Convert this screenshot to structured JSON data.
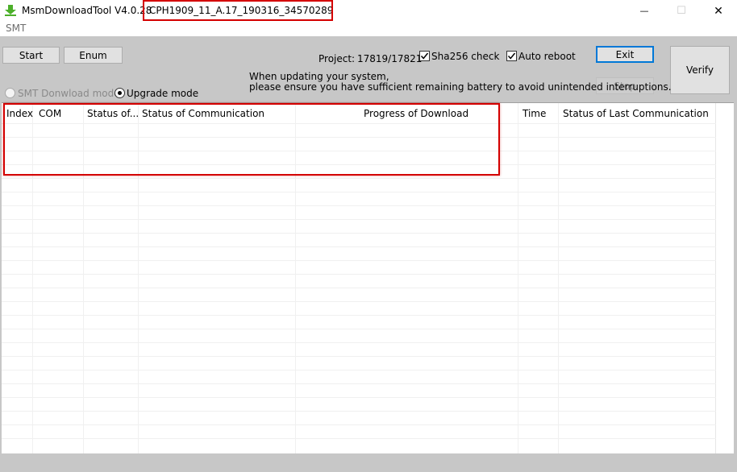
{
  "window": {
    "app_title": "MsmDownloadTool V4.0.28",
    "title_separator": "-",
    "project_name": "CPH1909_11_A.17_190316_34570289",
    "minimize_glyph": "—",
    "maximize_glyph": "☐",
    "close_glyph": "✕"
  },
  "menu": {
    "items": [
      "SMT"
    ]
  },
  "toolbar": {
    "start_label": "Start",
    "enum_label": "Enum",
    "project_label": "Project:",
    "project_value": "17819/17821",
    "sha256_label": "Sha256 check",
    "sha256_checked": true,
    "auto_reboot_label": "Auto reboot",
    "auto_reboot_checked": true,
    "exit_label": "Exit",
    "stop_label": "Stop",
    "verify_label": "Verify",
    "notice_line1": "When updating your system,",
    "notice_line2": "please ensure you have sufficient remaining battery to avoid unintended interruptions.",
    "smt_mode_label": "SMT Donwload mode",
    "upgrade_mode_label": "Upgrade mode",
    "selected_mode": "upgrade"
  },
  "grid": {
    "columns": [
      "Index",
      "COM",
      "Status of...",
      "Status of Communication",
      "Progress of Download",
      "Time",
      "Status of Last Communication"
    ],
    "rows": []
  },
  "colors": {
    "toolbar_bg": "#c7c7c7",
    "highlight_red": "#d40000",
    "accent_blue": "#0078d7",
    "download_icon_green": "#4caf2a"
  },
  "icons": {
    "app": "download-arrow-icon",
    "check": "checkmark-icon"
  }
}
